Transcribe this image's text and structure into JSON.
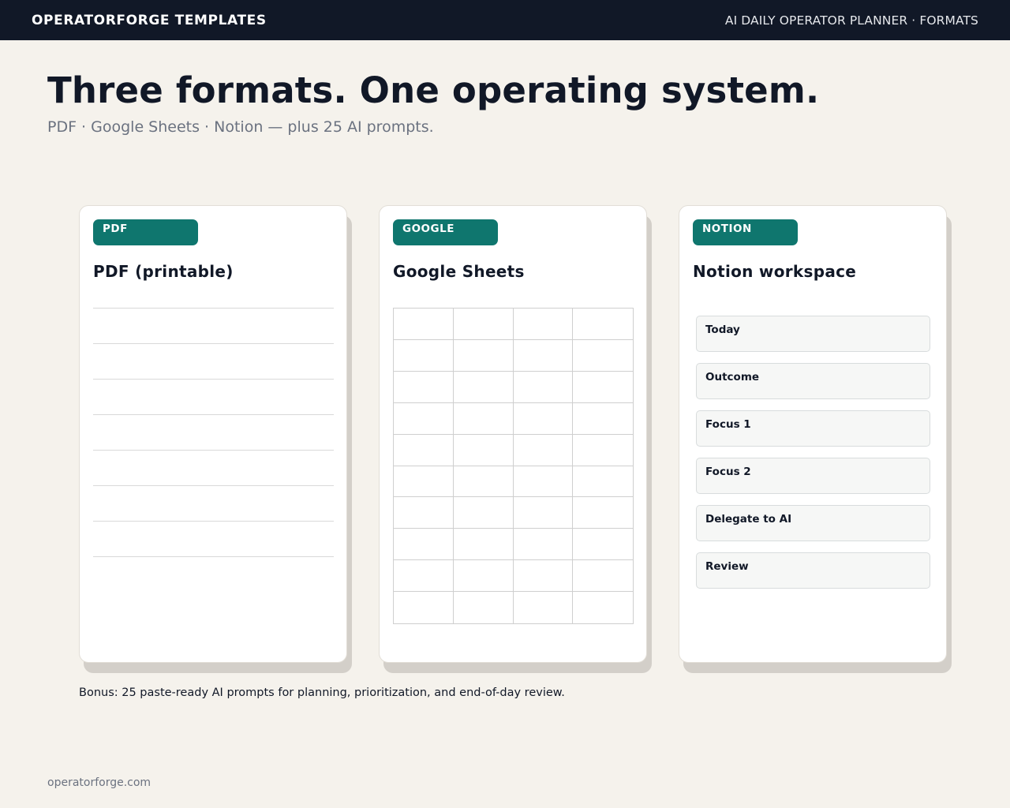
{
  "header": {
    "brand": "OPERATORFORGE TEMPLATES",
    "right": "AI DAILY OPERATOR PLANNER · FORMATS"
  },
  "hero": {
    "title": "Three formats. One operating system.",
    "subtitle": "PDF · Google Sheets · Notion — plus 25 AI prompts."
  },
  "cards": [
    {
      "badge": "PDF",
      "title": "PDF (printable)"
    },
    {
      "badge": "GOOGLE",
      "title": "Google Sheets"
    },
    {
      "badge": "NOTION",
      "title": "Notion workspace",
      "blocks": [
        "Today",
        "Outcome",
        "Focus 1",
        "Focus 2",
        "Delegate to AI",
        "Review"
      ]
    }
  ],
  "bonus": "Bonus: 25 paste-ready AI prompts for planning, prioritization, and end-of-day review.",
  "footer": "operatorforge.com",
  "colors": {
    "header_bg": "#111827",
    "page_bg": "#f5f2ec",
    "badge": "#0f766e",
    "card_shadow": "#d3cfc9"
  }
}
